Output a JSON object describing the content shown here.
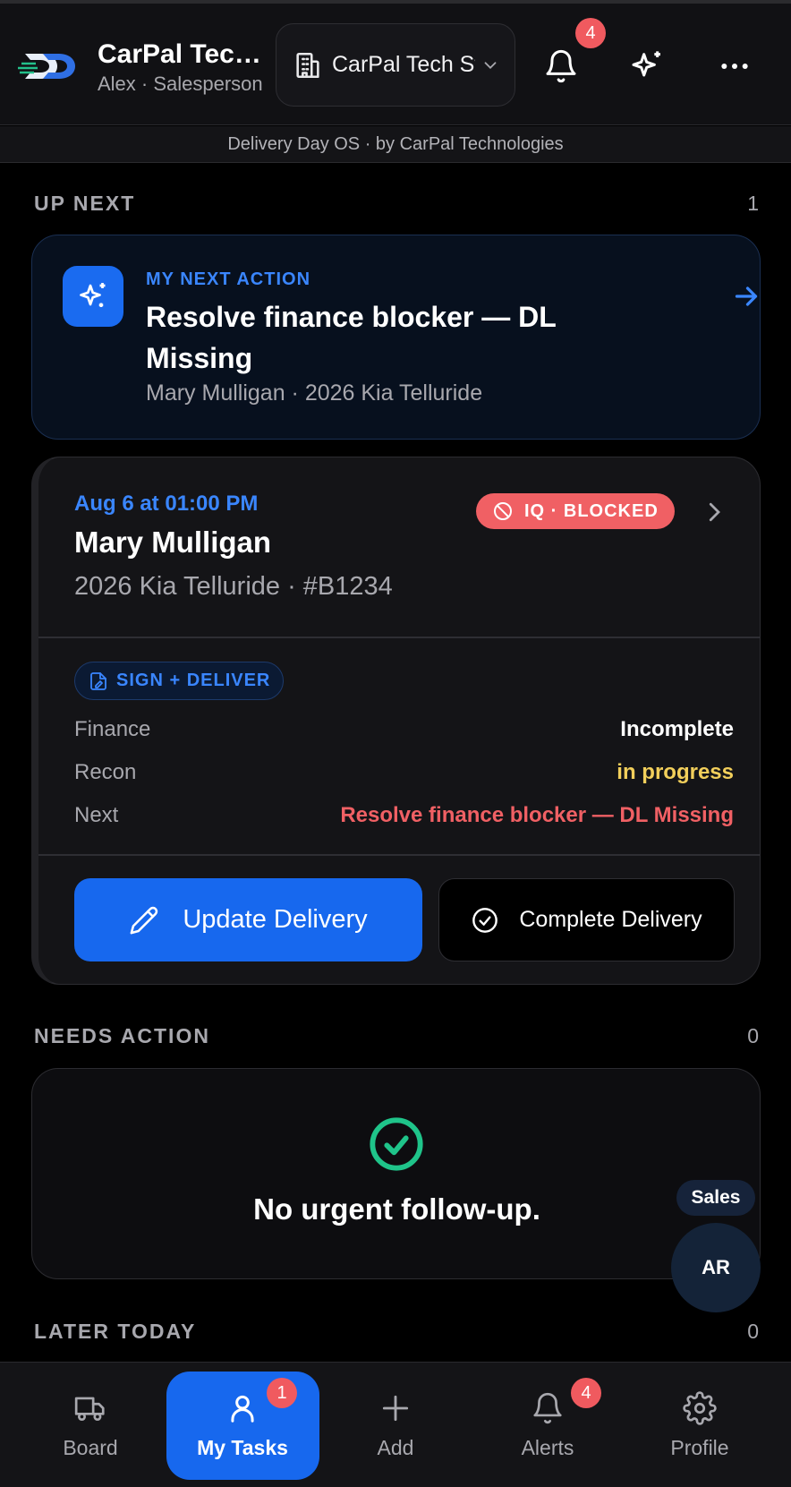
{
  "header": {
    "brand_title": "CarPal Tech Store",
    "brand_subtitle": "Alex · Salesperson",
    "store_selector": "CarPal Tech Store",
    "notification_count": "4"
  },
  "subbar": "Delivery Day OS · by CarPal Technologies",
  "up_next": {
    "heading": "UP NEXT",
    "count": "1",
    "next_action": {
      "kicker": "MY NEXT ACTION",
      "title": "Resolve finance blocker — DL Missing",
      "subtitle": "Mary Mulligan · 2026 Kia Telluride"
    }
  },
  "delivery": {
    "datetime": "Aug 6 at 01:00 PM",
    "customer": "Mary Mulligan",
    "vehicle": "2026 Kia Telluride · #B1234",
    "status_badge": "IQ · BLOCKED",
    "type_pill": "SIGN + DELIVER",
    "rows": [
      {
        "label": "Finance",
        "value": "Incomplete",
        "color": "#ffffff"
      },
      {
        "label": "Recon",
        "value": "in progress",
        "color": "#f2cf5b"
      },
      {
        "label": "Next",
        "value": "Resolve finance blocker — DL Missing",
        "color": "#f06064"
      }
    ],
    "update_button": "Update Delivery",
    "complete_button": "Complete Delivery"
  },
  "needs_action": {
    "heading": "NEEDS ACTION",
    "count": "0",
    "empty_text": "No urgent follow-up."
  },
  "later_today": {
    "heading": "LATER TODAY",
    "count": "0"
  },
  "floating": {
    "role_tag": "Sales",
    "avatar_initials": "AR"
  },
  "bottom_nav": {
    "items": [
      {
        "label": "Board",
        "icon": "truck-icon"
      },
      {
        "label": "My Tasks",
        "icon": "user-icon",
        "badge": "1",
        "active": true
      },
      {
        "label": "Add",
        "icon": "plus-icon"
      },
      {
        "label": "Alerts",
        "icon": "bell-icon",
        "badge": "4"
      },
      {
        "label": "Profile",
        "icon": "gear-icon"
      }
    ]
  },
  "colors": {
    "accent": "#1768ee",
    "blocked": "#f06064",
    "warning": "#f2cf5b",
    "success": "#1fc48a"
  }
}
